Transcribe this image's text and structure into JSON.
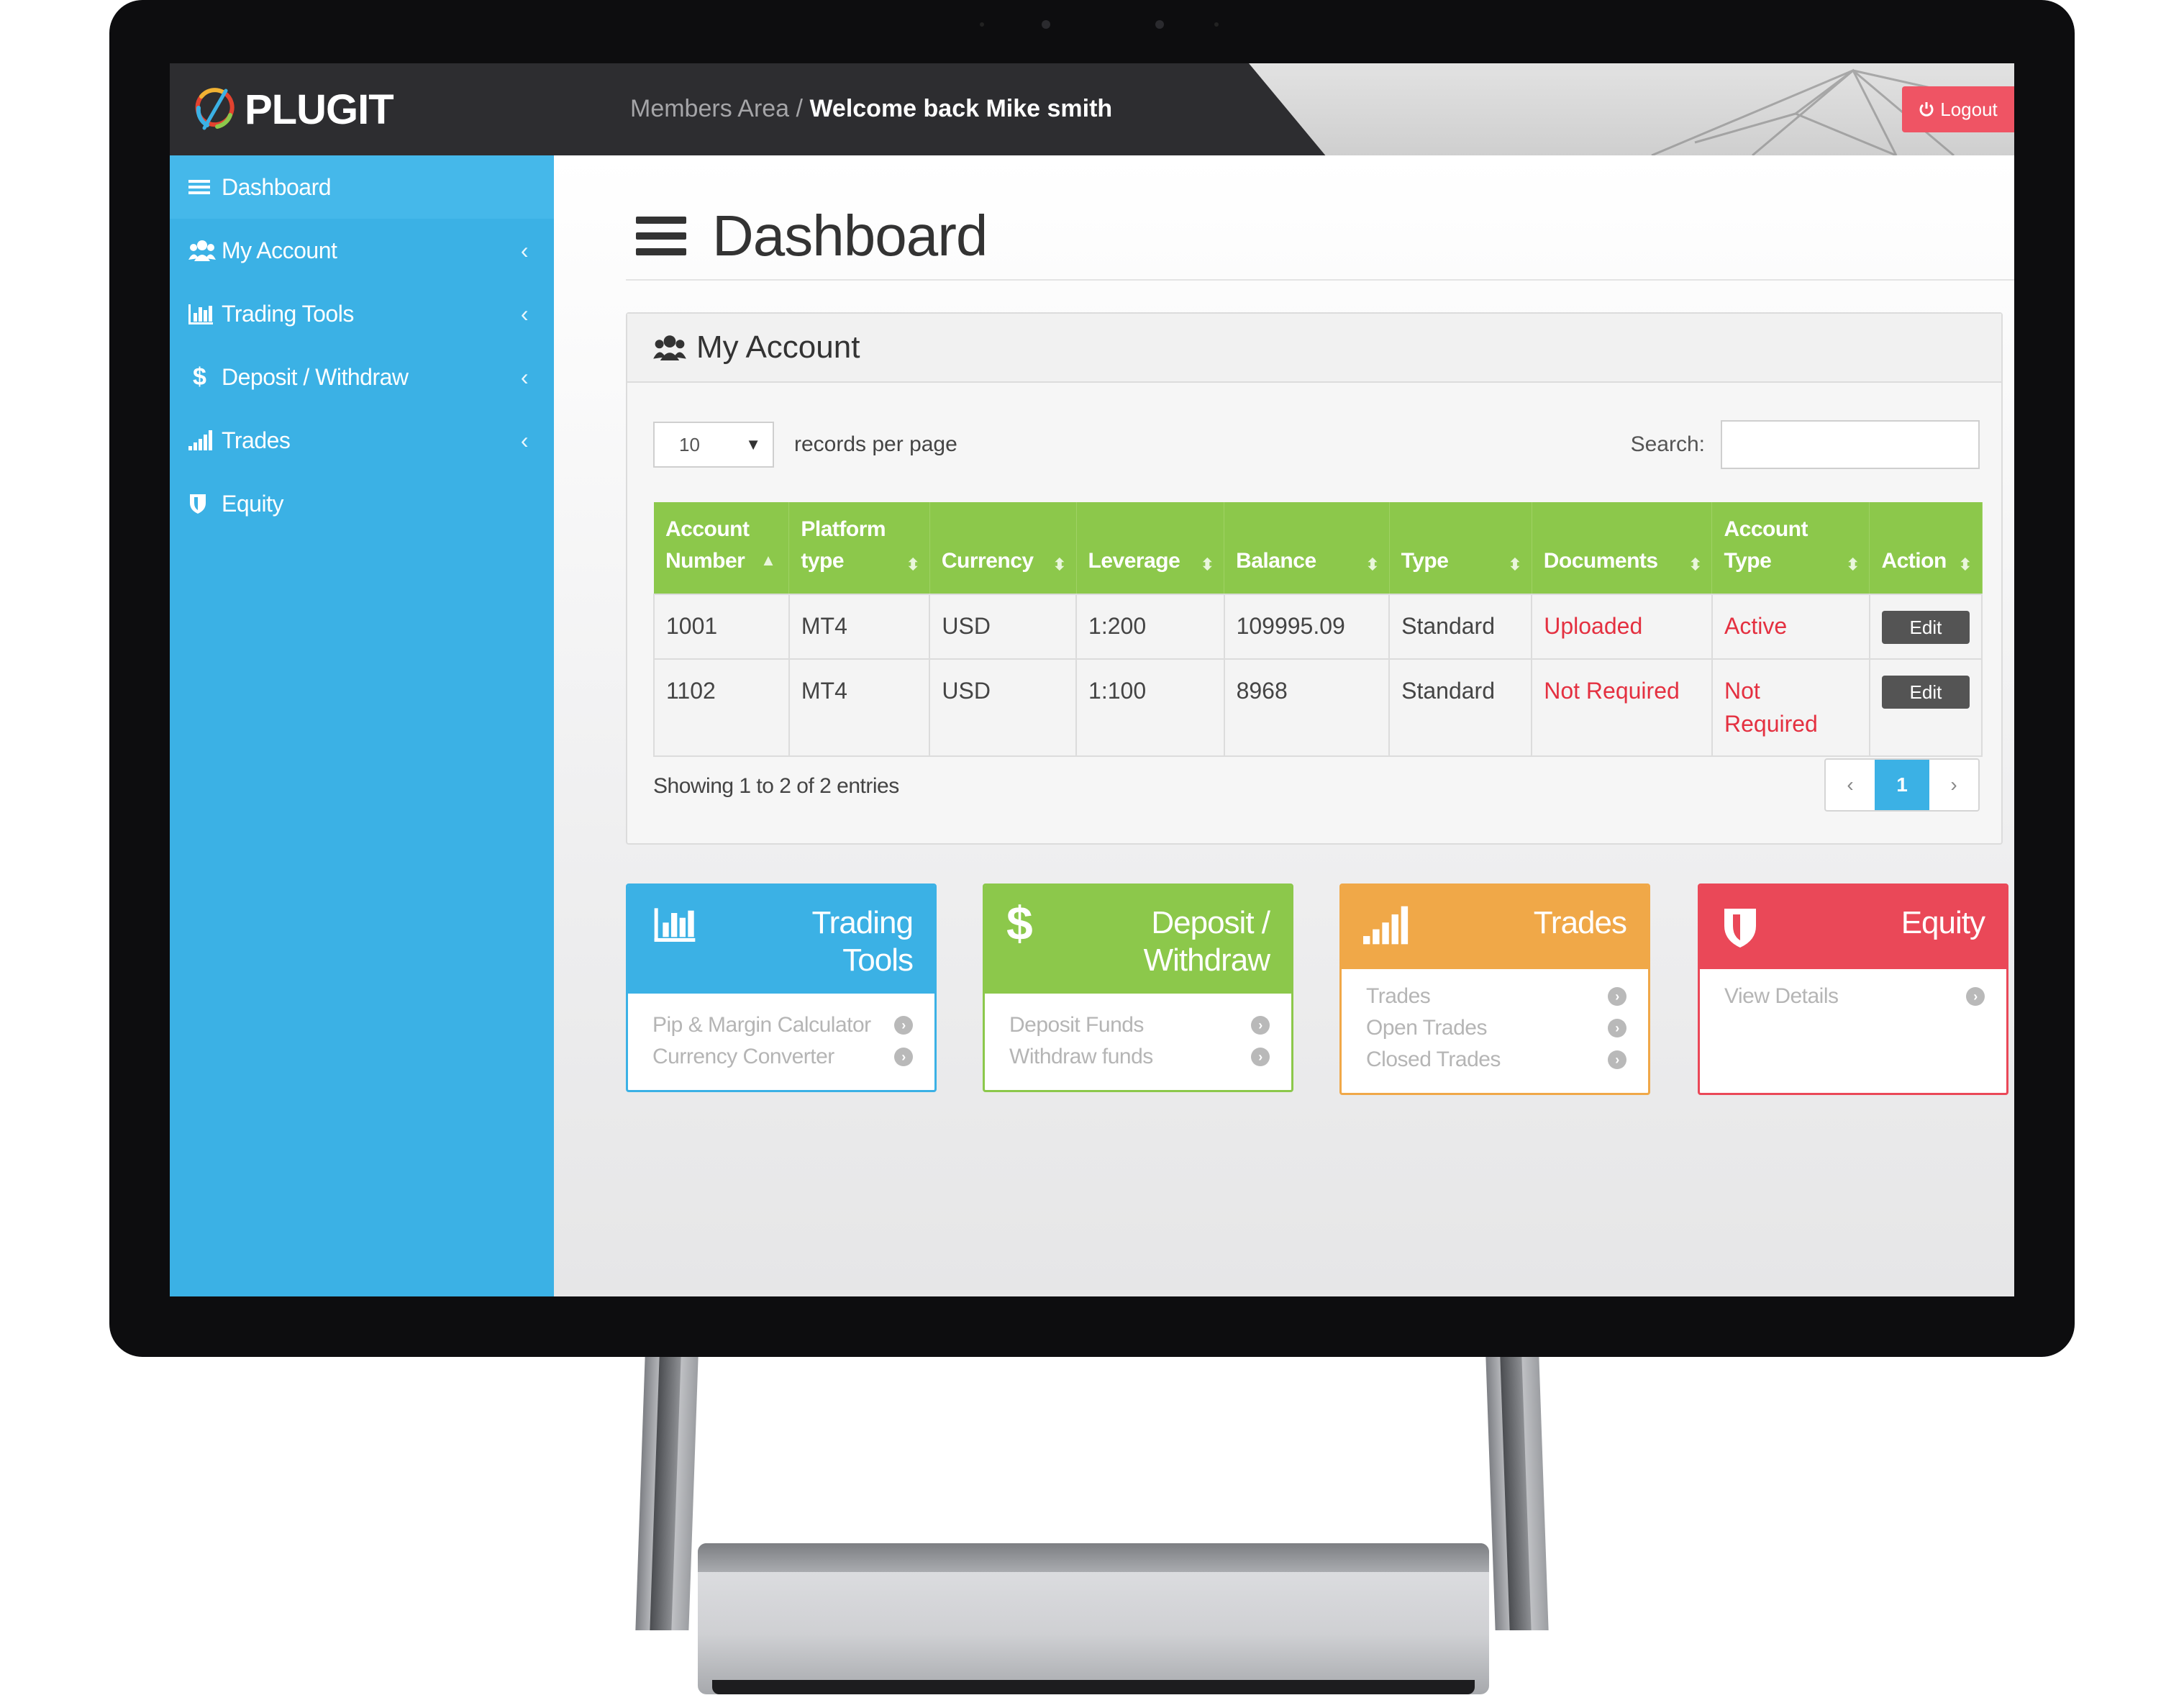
{
  "brand": {
    "name": "PLUGIT",
    "colors": {
      "accent": "#3bb1e5",
      "green": "#8cc84b",
      "orange": "#f0a848",
      "red": "#ea4858",
      "dark": "#2d2d30"
    }
  },
  "header": {
    "breadcrumb_root": "Members Area /",
    "welcome": "Welcome back Mike smith",
    "logout_label": "Logout",
    "logout_icon": "power-icon"
  },
  "sidebar": {
    "items": [
      {
        "label": "Dashboard",
        "icon": "menu-icon",
        "active": true
      },
      {
        "label": "My Account",
        "icon": "users-icon"
      },
      {
        "label": "Trading Tools",
        "icon": "bar-chart-icon"
      },
      {
        "label": "Deposit / Withdraw",
        "icon": "dollar-icon"
      },
      {
        "label": "Trades",
        "icon": "signal-icon"
      },
      {
        "label": "Equity",
        "icon": "shield-icon"
      }
    ],
    "chevron": "‹"
  },
  "page": {
    "title": "Dashboard"
  },
  "account_panel": {
    "title": "My Account",
    "records_per_page": {
      "value": "10",
      "label": "records per page"
    },
    "search_label": "Search:",
    "search_value": "",
    "columns": [
      {
        "line1": "Account",
        "line2": "Number",
        "sort": "▲"
      },
      {
        "line1": "Platform",
        "line2": "type",
        "sort": "⬍"
      },
      {
        "line1": "",
        "line2": "Currency",
        "sort": "⬍"
      },
      {
        "line1": "",
        "line2": "Leverage",
        "sort": "⬍"
      },
      {
        "line1": "",
        "line2": "Balance",
        "sort": "⬍"
      },
      {
        "line1": "",
        "line2": "Type",
        "sort": "⬍"
      },
      {
        "line1": "",
        "line2": "Documents",
        "sort": "⬍"
      },
      {
        "line1": "Account",
        "line2": "Type",
        "sort": "⬍"
      },
      {
        "line1": "",
        "line2": "Action",
        "sort": "⬍"
      }
    ],
    "rows": [
      {
        "account_number": "1001",
        "platform": "MT4",
        "currency": "USD",
        "leverage": "1:200",
        "balance": "109995.09",
        "type": "Standard",
        "documents": "Uploaded",
        "account_type": "Active",
        "action": "Edit"
      },
      {
        "account_number": "1102",
        "platform": "MT4",
        "currency": "USD",
        "leverage": "1:100",
        "balance": "8968",
        "type": "Standard",
        "documents": "Not Required",
        "account_type": "Not Required",
        "action": "Edit"
      }
    ],
    "showing": "Showing 1 to 2 of 2 entries",
    "pagination": {
      "prev": "‹",
      "current": "1",
      "next": "›"
    }
  },
  "tiles": {
    "trading": {
      "title": "Trading Tools",
      "icon": "bar-chart-icon",
      "links": [
        "Pip & Margin Calculator",
        "Currency Converter"
      ]
    },
    "deposit": {
      "title": "Deposit / Withdraw",
      "icon": "dollar-icon",
      "links": [
        "Deposit Funds",
        "Withdraw funds"
      ]
    },
    "trades": {
      "title": "Trades",
      "icon": "signal-icon",
      "links": [
        "Trades",
        "Open Trades",
        "Closed Trades"
      ]
    },
    "equity": {
      "title": "Equity",
      "icon": "shield-icon",
      "links": [
        "View Details"
      ]
    }
  }
}
